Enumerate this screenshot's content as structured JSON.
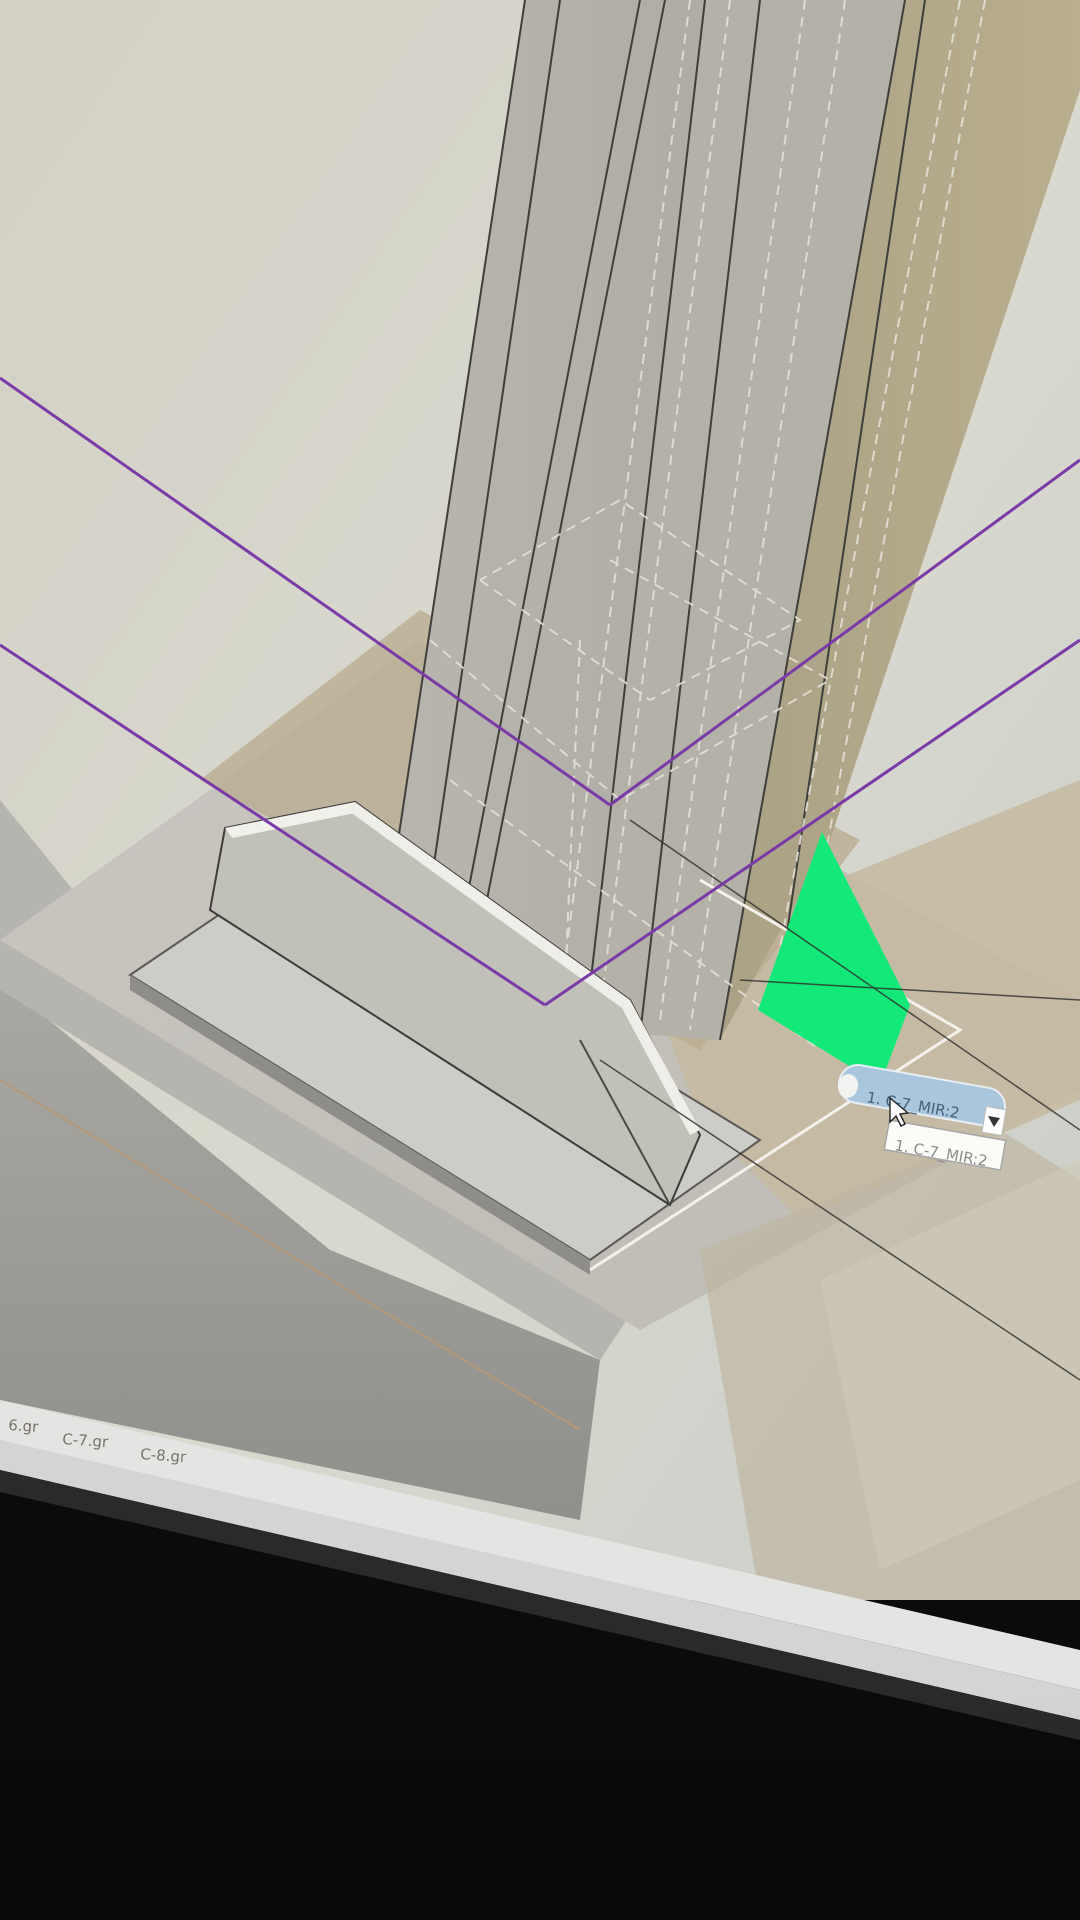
{
  "viewport": {
    "label": "3d-model-viewport",
    "selection": {
      "dropdown_value": "1. C-7_MIR:2",
      "tooltip_text": "1. C-7_MIR:2"
    },
    "bottom_tabs": [
      {
        "label": "6.gr"
      },
      {
        "label": "C-7.gr"
      },
      {
        "label": "C-8.gr"
      }
    ]
  },
  "colors": {
    "background": "#d7d7cd",
    "highlight_face": "#14e878",
    "reference_line": "#7a3aa8",
    "dropdown_fill": "#a9c6dd",
    "monitor_bezel": "#0b0b0c"
  },
  "icons": {
    "cursor": "mouse-pointer-icon",
    "dropdown": "chevron-down-icon"
  }
}
